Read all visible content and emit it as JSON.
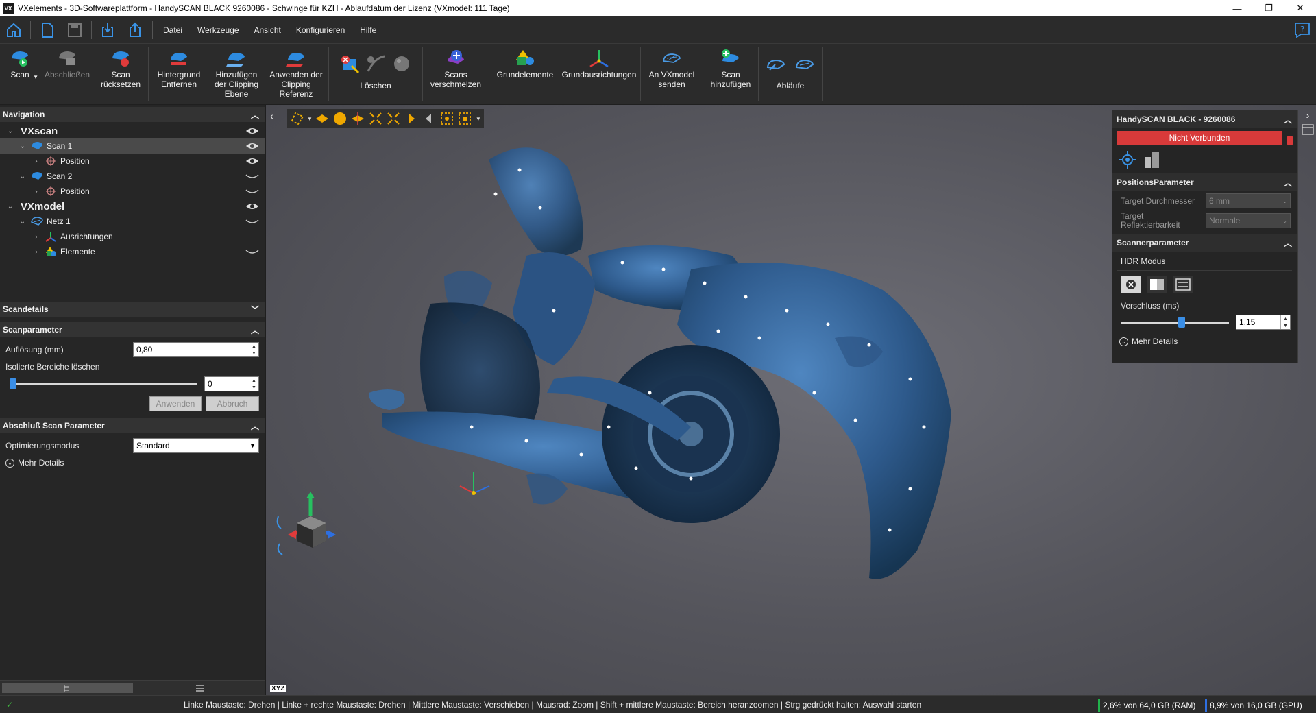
{
  "window": {
    "title": "VXelements - 3D-Softwareplattform - HandySCAN BLACK 9260086 - Schwinge für KZH - Ablaufdatum der Lizenz (VXmodel: 111 Tage)",
    "logo_text": "VX",
    "min": "—",
    "max": "❐",
    "close": "✕"
  },
  "menu": [
    "Datei",
    "Werkzeuge",
    "Ansicht",
    "Konfigurieren",
    "Hilfe"
  ],
  "ribbon": {
    "scan": "Scan",
    "abschliessen": "Abschließen",
    "scan_reset": [
      "Scan",
      "rücksetzen"
    ],
    "hintergrund": [
      "Hintergrund",
      "Entfernen"
    ],
    "clipping_add": [
      "Hinzufügen",
      "der Clipping",
      "Ebene"
    ],
    "clipping_apply": [
      "Anwenden der",
      "Clipping",
      "Referenz"
    ],
    "loeschen": "Löschen",
    "verschmelzen": [
      "Scans",
      "verschmelzen"
    ],
    "grundelemente": "Grundelemente",
    "grundausrichtungen": "Grundausrichtungen",
    "vxmodel_send": [
      "An VXmodel",
      "senden"
    ],
    "scan_add": [
      "Scan",
      "hinzufügen"
    ],
    "ablaeufe": "Abläufe"
  },
  "nav": {
    "title": "Navigation",
    "vxscan": "VXscan",
    "scan1": "Scan 1",
    "position1": "Position",
    "scan2": "Scan 2",
    "position2": "Position",
    "vxmodel": "VXmodel",
    "netz1": "Netz 1",
    "ausrichtungen": "Ausrichtungen",
    "elemente": "Elemente"
  },
  "scandetails": {
    "title": "Scandetails"
  },
  "scanparameter": {
    "title": "Scanparameter",
    "aufloesung_label": "Auflösung (mm)",
    "aufloesung_value": "0,80",
    "isoliert_label": "Isolierte Bereiche löschen",
    "isoliert_value": "0",
    "isoliert_level": 0,
    "anwenden": "Anwenden",
    "abbruch": "Abbruch"
  },
  "abschluss": {
    "title": "Abschluß Scan Parameter",
    "optimierung_label": "Optimierungsmodus",
    "optimierung_value": "Standard",
    "mehr": "Mehr Details"
  },
  "scanner_panel": {
    "title": "HandySCAN BLACK - 9260086",
    "status": "Nicht Verbunden",
    "status_color": "#d83a3a",
    "pos_title": "PositionsParameter",
    "target_d_label": "Target Durchmesser",
    "target_d_value": "6 mm",
    "target_r_label1": "Target",
    "target_r_label2": "Reflektierbarkeit",
    "target_r_value": "Normale",
    "scanner_title": "Scannerparameter",
    "hdr_label": "HDR Modus",
    "verschluss_label": "Verschluss (ms)",
    "verschluss_value": "1,15",
    "mehr": "Mehr Details"
  },
  "viewport": {
    "xyz": "XYZ"
  },
  "statusbar": {
    "hint": "Linke Maustaste: Drehen  |  Linke + rechte Maustaste: Drehen  |  Mittlere Maustaste: Verschieben  |  Mausrad: Zoom  |  Shift + mittlere Maustaste: Bereich heranzoomen  |  Strg gedrückt halten: Auswahl starten",
    "ram": "2,6% von 64,0 GB (RAM)",
    "gpu": "8,9% von 16,0 GB (GPU)"
  },
  "colors": {
    "accent": "#2f6fe0",
    "scan_blue": "#2e5a8c",
    "ok": "#21b24b"
  }
}
